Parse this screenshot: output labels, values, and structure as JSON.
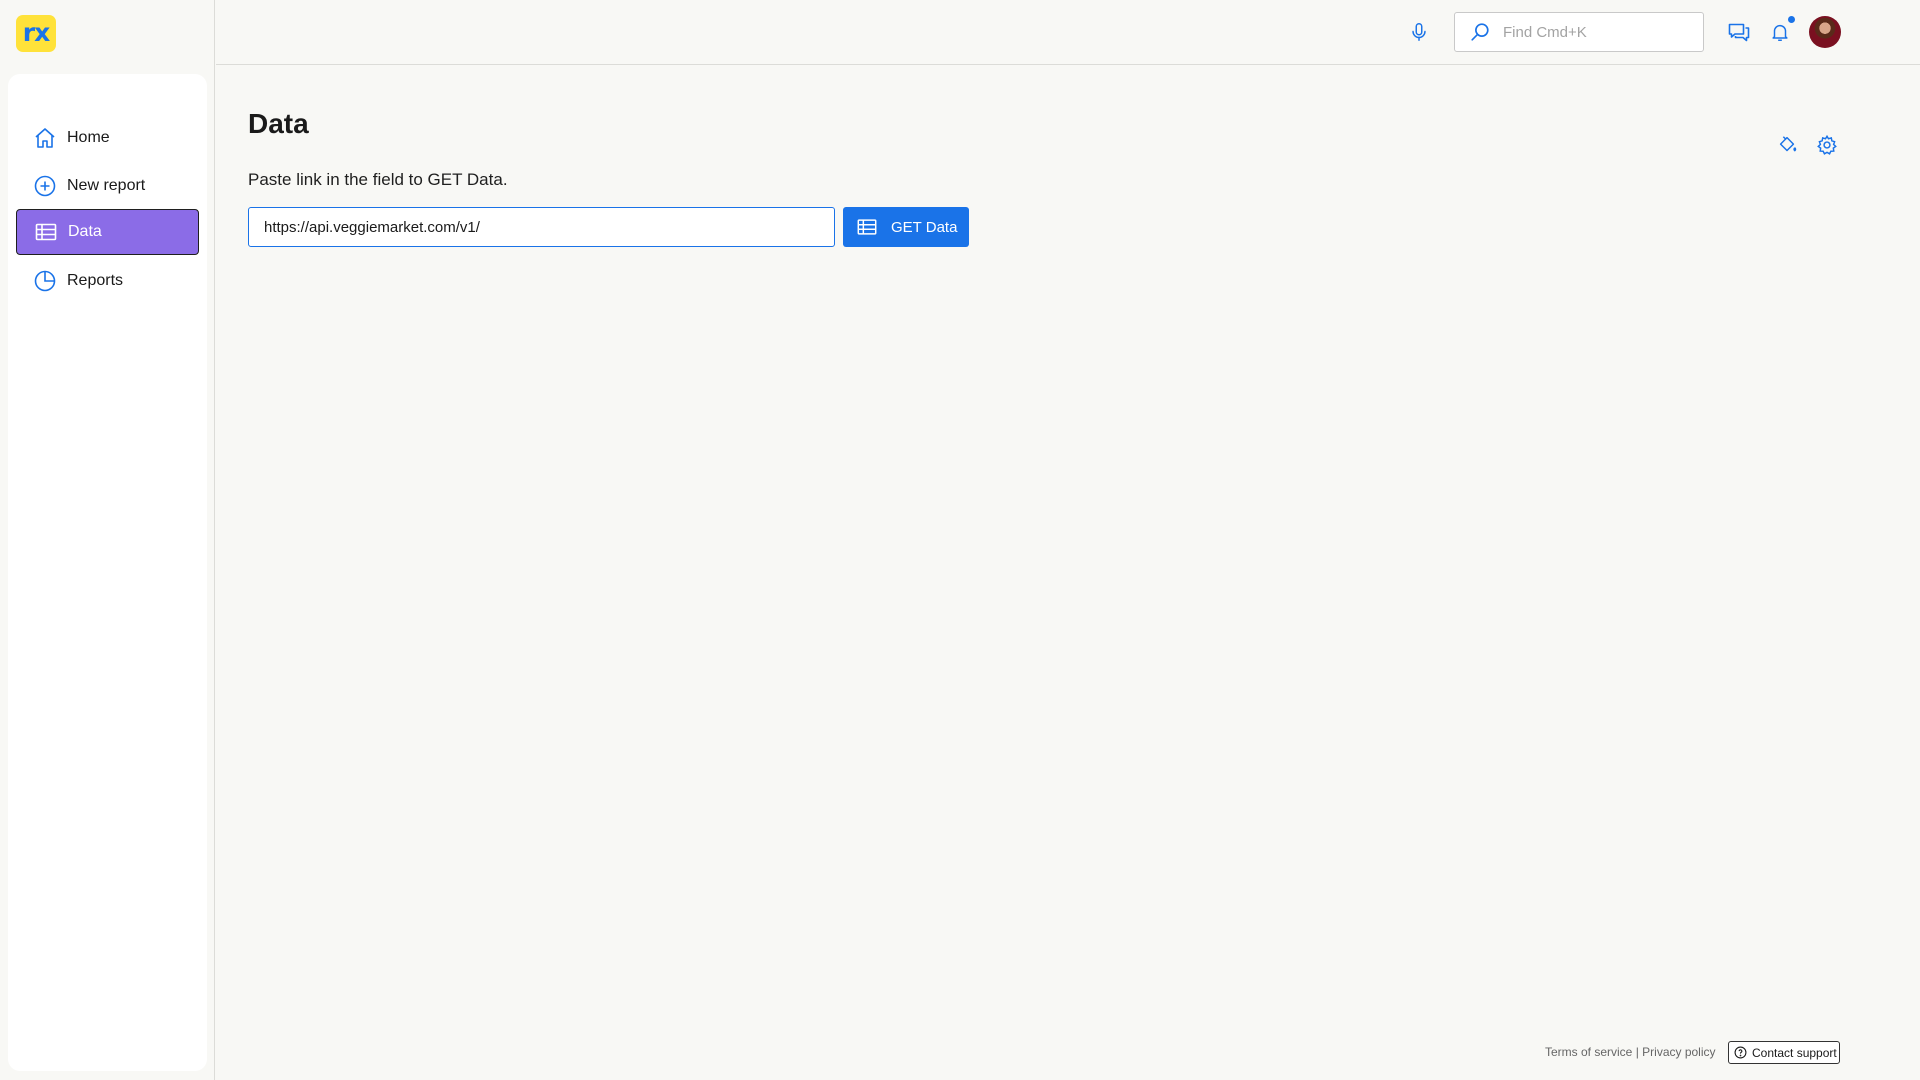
{
  "app": {
    "logo_text": "rx",
    "brand_color": "#ffe23a",
    "accent_color": "#1a73e8",
    "active_nav_color": "#8b6ce7"
  },
  "header": {
    "search": {
      "placeholder": "Find Cmd+K",
      "icon": "search-icon"
    },
    "icons": [
      "microphone-icon",
      "chat-icon",
      "bell-icon"
    ],
    "has_notification": true
  },
  "sidebar": {
    "items": [
      {
        "label": "Home",
        "icon": "home-icon",
        "active": false
      },
      {
        "label": "New report",
        "icon": "plus-circle-icon",
        "active": false
      },
      {
        "label": "Data",
        "icon": "table-icon",
        "active": true
      },
      {
        "label": "Reports",
        "icon": "pie-chart-icon",
        "active": false
      }
    ]
  },
  "main": {
    "title": "Data",
    "instruction": "Paste link in the field to GET Data.",
    "url_value": "https://api.veggiemarket.com/v1/",
    "get_button_label": "GET Data",
    "tools": [
      "paint-bucket-icon",
      "gear-icon"
    ]
  },
  "footer": {
    "terms": "Terms of service",
    "separator": " | ",
    "privacy": "Privacy policy",
    "support_label": "Contact support"
  }
}
